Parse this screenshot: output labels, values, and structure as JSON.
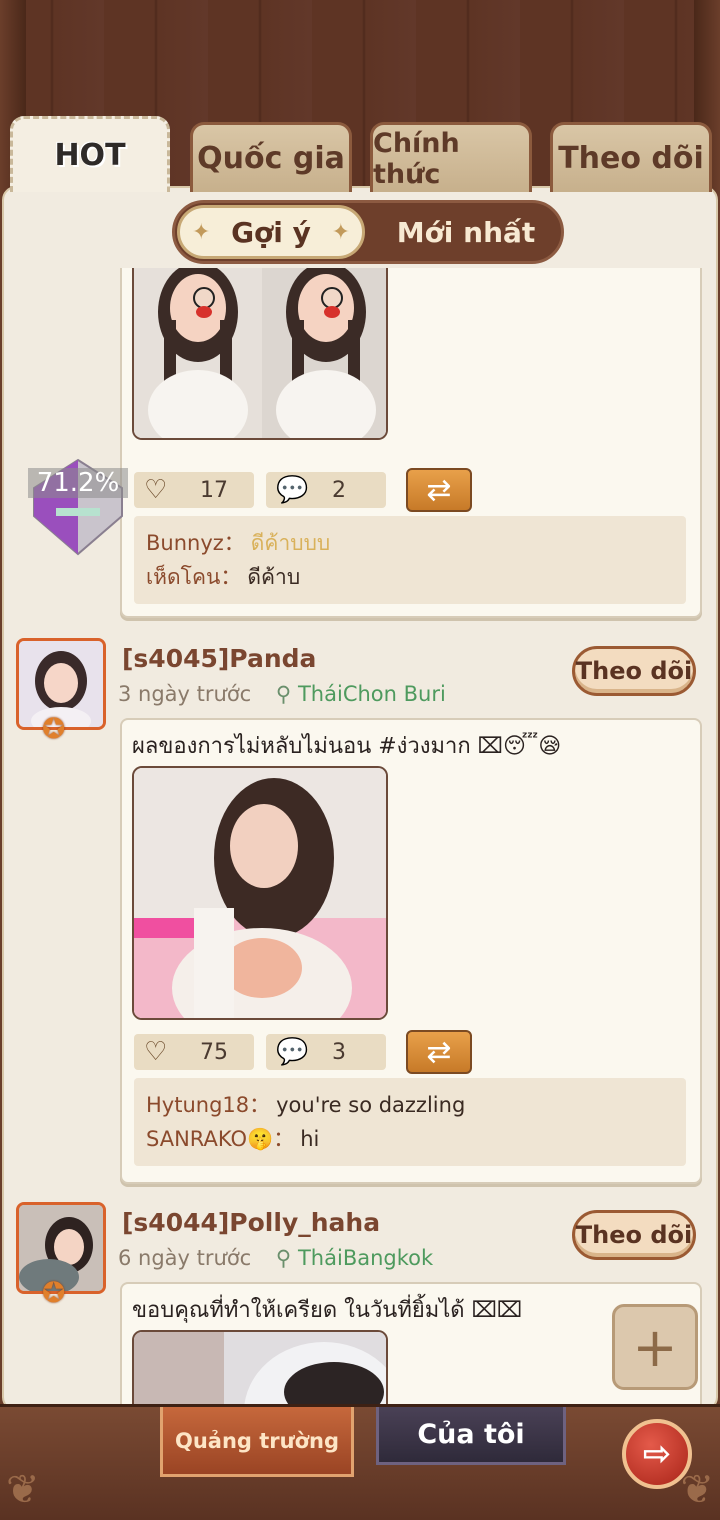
{
  "tabs": [
    {
      "label": "HOT",
      "active": true
    },
    {
      "label": "Quốc gia",
      "active": false
    },
    {
      "label": "Chính thức",
      "active": false
    },
    {
      "label": "Theo dõi",
      "active": false
    }
  ],
  "subtabs": {
    "suggested": "Gợi ý",
    "newest": "Mới nhất",
    "active": "suggested"
  },
  "progress_widget": {
    "label": "71.2%",
    "value": 0.712
  },
  "posts": [
    {
      "partial": true,
      "likes": "17",
      "comments_count": "2",
      "comments": [
        {
          "user": "Bunnyz：",
          "text": "ดีค้าบบบ",
          "highlight": true
        },
        {
          "user": "เห็ดโคน：",
          "text": "ดีค้าบ",
          "highlight": false
        }
      ]
    },
    {
      "name": "[s4045]Panda",
      "time": "3 ngày trước",
      "location": "TháiChon Buri",
      "follow_label": "Theo dõi",
      "text": "ผลของการไม่หลับไม่นอน #ง่วงมาก ⌧😴😪",
      "likes": "75",
      "comments_count": "3",
      "comments": [
        {
          "user": "Hytung18：",
          "text": "you're so dazzling",
          "highlight": false
        },
        {
          "user": "SANRAKO🤫：",
          "text": "hi",
          "highlight": false
        }
      ]
    },
    {
      "name": "[s4044]Polly_haha",
      "time": "6 ngày trước",
      "location": "TháiBangkok",
      "follow_label": "Theo dõi",
      "text": "ขอบคุณที่ทำให้เครียด ในวันที่ยิ้มได้ ⌧⌧"
    }
  ],
  "icons": {
    "like": "heart-icon",
    "comment": "speech-bubble-icon",
    "repost": "repost-icon",
    "location": "location-pin-icon",
    "add": "plus-icon",
    "exit": "exit-icon"
  },
  "bottom_bar": {
    "plaza": "Quảng trường",
    "mine": "Của tôi"
  },
  "colors": {
    "accent_brown": "#6e3f2b",
    "follow_border": "#9b5a33",
    "location_green": "#4e9a5e",
    "panel_bg": "#f1ebe0"
  }
}
